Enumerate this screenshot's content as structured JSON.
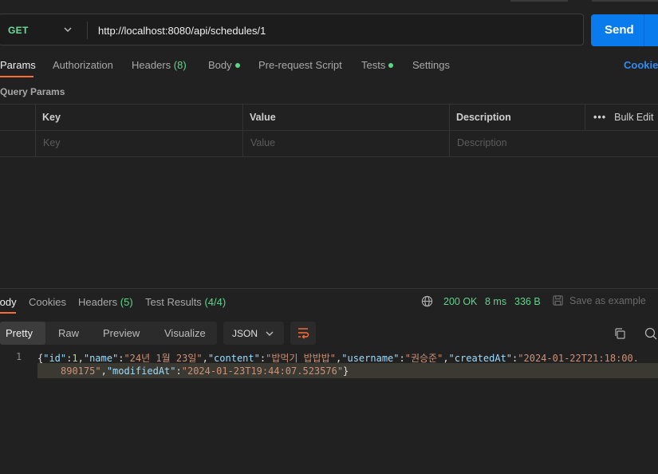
{
  "request": {
    "method": "GET",
    "url": "http://localhost:8080/api/schedules/1",
    "send_label": "Send"
  },
  "request_tabs": {
    "params": "Params",
    "authorization": "Authorization",
    "headers": "Headers",
    "headers_count": "(8)",
    "body": "Body",
    "prerequest": "Pre-request Script",
    "tests": "Tests",
    "settings": "Settings",
    "cookies": "Cookies"
  },
  "query_params": {
    "title": "Query Params",
    "columns": {
      "key": "Key",
      "value": "Value",
      "description": "Description"
    },
    "bulk_edit": "Bulk Edit",
    "placeholders": {
      "key": "Key",
      "value": "Value",
      "description": "Description"
    }
  },
  "response_tabs": {
    "body": "Body",
    "cookies": "Cookies",
    "headers": "Headers",
    "headers_count": "(5)",
    "test_results": "Test Results",
    "test_results_count": "(4/4)"
  },
  "response_status": {
    "status": "200 OK",
    "time": "8 ms",
    "size": "336 B",
    "save_example": "Save as example"
  },
  "format": {
    "pretty": "Pretty",
    "raw": "Raw",
    "preview": "Preview",
    "visualize": "Visualize",
    "language": "JSON"
  },
  "response_body": {
    "line_number": "1",
    "fields": {
      "id_key": "\"id\"",
      "id_val": "1",
      "name_key": "\"name\"",
      "name_val": "\"24년 1월 23일\"",
      "content_key": "\"content\"",
      "content_val": "\"밥먹기 밥밥밥\"",
      "username_key": "\"username\"",
      "username_val": "\"권승준\"",
      "createdAt_key": "\"createdAt\"",
      "createdAt_val_part1": "\"2024-01-22T21:18:00.",
      "createdAt_val_part2": "890175\"",
      "modifiedAt_key": "\"modifiedAt\"",
      "modifiedAt_val": "\"2024-01-23T19:44:07.523576\""
    }
  },
  "colors": {
    "accent": "#ff6c37",
    "send": "#097bed",
    "success": "#5ed689",
    "method_get": "#6bdd9a",
    "link": "#2f8cf5"
  }
}
